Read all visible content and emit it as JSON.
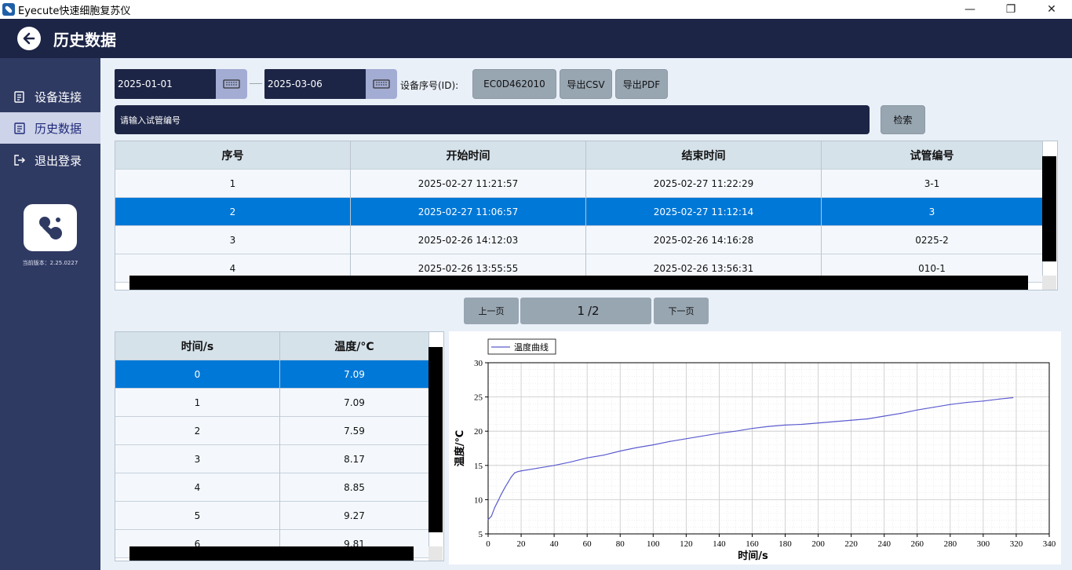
{
  "window": {
    "title": "Eyecute快速细胞复苏仪",
    "minimize": "—",
    "restore": "❐",
    "close": "✕"
  },
  "header": {
    "title": "历史数据"
  },
  "sidebar": {
    "items": [
      {
        "label": "设备连接",
        "icon": "device-connect-icon"
      },
      {
        "label": "历史数据",
        "icon": "history-data-icon",
        "active": true
      },
      {
        "label": "退出登录",
        "icon": "logout-icon"
      }
    ],
    "version": "当前版本：2.25.0227"
  },
  "filters": {
    "start_date": "2025-01-01",
    "end_date": "2025-03-06",
    "device_id_label": "设备序号(ID):",
    "device_id": "EC0D462010",
    "export_csv": "导出CSV",
    "export_pdf": "导出PDF",
    "search_placeholder": "请输入试管编号",
    "search_button": "检索"
  },
  "records_table": {
    "headers": [
      "序号",
      "开始时间",
      "结束时间",
      "试管编号"
    ],
    "rows": [
      [
        "1",
        "2025-02-27 11:21:57",
        "2025-02-27 11:22:29",
        "3-1"
      ],
      [
        "2",
        "2025-02-27 11:06:57",
        "2025-02-27 11:12:14",
        "3"
      ],
      [
        "3",
        "2025-02-26 14:12:03",
        "2025-02-26 14:16:28",
        "0225-2"
      ],
      [
        "4",
        "2025-02-26 13:55:55",
        "2025-02-26 13:56:31",
        "010-1"
      ]
    ],
    "selected_row": 2
  },
  "pager": {
    "prev": "上一页",
    "current": "1",
    "total": "/2",
    "next": "下一页"
  },
  "temp_table": {
    "headers": [
      "时间/s",
      "温度/°C"
    ],
    "rows": [
      [
        "0",
        "7.09"
      ],
      [
        "1",
        "7.09"
      ],
      [
        "2",
        "7.59"
      ],
      [
        "3",
        "8.17"
      ],
      [
        "4",
        "8.85"
      ],
      [
        "5",
        "9.27"
      ],
      [
        "6",
        "9.81"
      ]
    ],
    "selected_row": 0
  },
  "chart_data": {
    "type": "line",
    "legend": [
      "温度曲线"
    ],
    "legend_position": "top-left",
    "xlabel": "时间/s",
    "ylabel": "温度/℃",
    "xlim": [
      0,
      340
    ],
    "ylim": [
      5,
      30
    ],
    "xticks": [
      0,
      20,
      40,
      60,
      80,
      100,
      120,
      140,
      160,
      180,
      200,
      220,
      240,
      260,
      280,
      300,
      320,
      340
    ],
    "yticks": [
      5,
      10,
      15,
      20,
      25,
      30
    ],
    "grid": true,
    "line_color": "#5c5ccf",
    "series": [
      {
        "name": "温度曲线",
        "x": [
          0,
          2,
          4,
          6,
          8,
          10,
          12,
          14,
          16,
          18,
          20,
          25,
          30,
          40,
          50,
          60,
          70,
          80,
          90,
          100,
          110,
          120,
          130,
          140,
          150,
          160,
          170,
          180,
          190,
          200,
          210,
          220,
          230,
          240,
          250,
          260,
          270,
          280,
          290,
          300,
          310,
          318
        ],
        "y": [
          7.09,
          7.59,
          8.85,
          9.81,
          10.8,
          11.7,
          12.5,
          13.3,
          13.9,
          14.1,
          14.2,
          14.4,
          14.6,
          15.0,
          15.5,
          16.1,
          16.5,
          17.1,
          17.6,
          18.0,
          18.5,
          18.9,
          19.3,
          19.7,
          20.0,
          20.4,
          20.7,
          20.9,
          21.0,
          21.2,
          21.4,
          21.6,
          21.8,
          22.2,
          22.6,
          23.1,
          23.5,
          23.9,
          24.2,
          24.4,
          24.7,
          24.9
        ]
      }
    ]
  }
}
